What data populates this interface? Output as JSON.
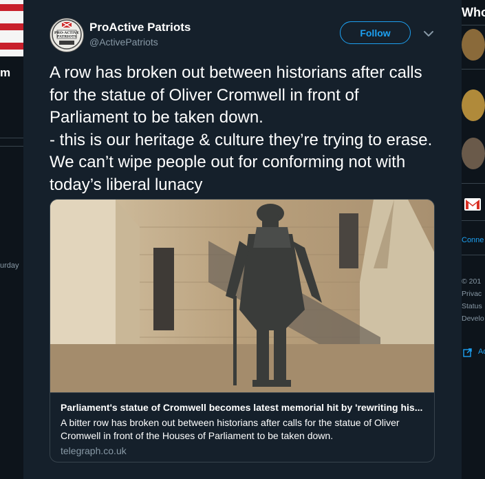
{
  "background_left": {
    "name_fragment": "m",
    "date_fragment": "urday"
  },
  "tweet": {
    "author_name": "ProActive Patriots",
    "author_handle": "@ActivePatriots",
    "avatar_text": "Pro-Active Patriots",
    "follow_label": "Follow",
    "text": "A row has broken out between historians after calls for the statue of Oliver Cromwell in front of Parliament to be taken down.\n- this is our heritage & culture they’re trying to erase. We can’t wipe people out for conforming not with today’s liberal lunacy"
  },
  "link_card": {
    "title": "Parliament's statue of Cromwell becomes latest memorial hit by 'rewriting his...",
    "description": "A bitter row has broken out between historians after calls for the statue of Oliver Cromwell in front of the Houses of Parliament to be taken down.",
    "domain": "telegraph.co.uk",
    "image_subject": "bronze statue of Oliver Cromwell in front of stone building"
  },
  "sidebar_right": {
    "heading_fragment": "Who",
    "connect_fragment": "Conne",
    "footer_lines": [
      "© 201",
      "Privac",
      "Status",
      "Develo"
    ],
    "ads_fragment": "Ad"
  },
  "colors": {
    "modal_bg": "#15202b",
    "page_bg": "#10171e",
    "accent": "#1da1f2",
    "secondary_text": "#8899a6",
    "border": "#38444d"
  }
}
